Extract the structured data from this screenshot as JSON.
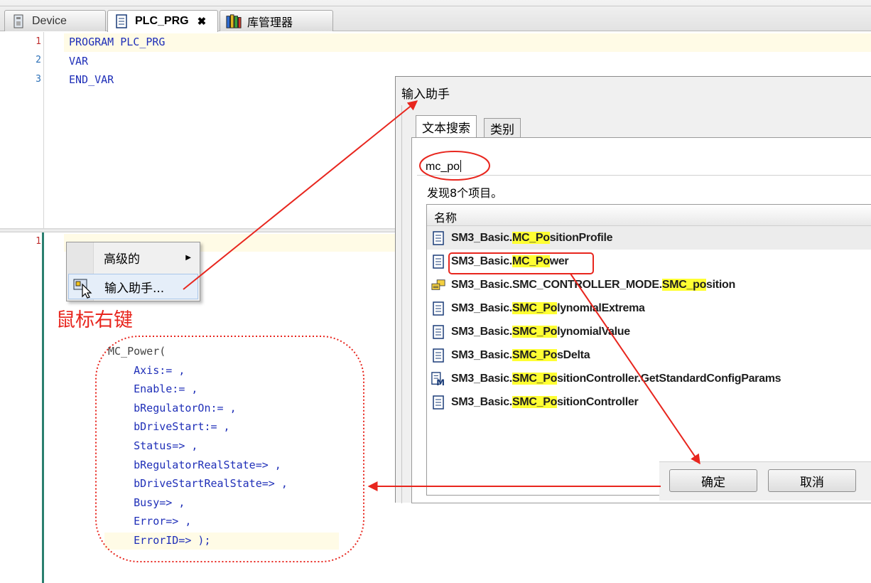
{
  "tabs": [
    {
      "label": "Device",
      "icon": "device-icon",
      "active": false
    },
    {
      "label": "PLC_PRG",
      "icon": "document-icon",
      "active": true
    },
    {
      "label": "库管理器",
      "icon": "books-icon",
      "active": false
    }
  ],
  "tab_close_glyph": "✖",
  "top_editor": {
    "line_numbers": [
      "1",
      "2",
      "3"
    ],
    "lines": [
      "PROGRAM PLC_PRG",
      "VAR",
      "END_VAR"
    ]
  },
  "bottom_editor": {
    "line_numbers": [
      "1"
    ],
    "code_lines": [
      "MC_Power(",
      "    Axis:= ,",
      "    Enable:= ,",
      "    bRegulatorOn:= ,",
      "    bDriveStart:= ,",
      "    Status=> ,",
      "    bRegulatorRealState=> ,",
      "    bDriveStartRealState=> ,",
      "    Busy=> ,",
      "    Error=> ,",
      "    ErrorID=> );"
    ]
  },
  "context_menu": {
    "items": [
      {
        "label": "高级的",
        "has_submenu": true
      },
      {
        "label": "输入助手...",
        "icon": "input-assistant-icon"
      }
    ],
    "submenu_arrow": "▶"
  },
  "annotation": {
    "label": "鼠标右键",
    "color": "#e8261e"
  },
  "dialog": {
    "title": "输入助手",
    "tabs": [
      "文本搜索",
      "类别"
    ],
    "search_value": "mc_po",
    "found_text": "发现8个项目。",
    "column_header": "名称",
    "results": [
      {
        "icon": "function-block-icon",
        "segments": [
          "SM3_Basic.",
          "MC_Po",
          "sitionProfile"
        ]
      },
      {
        "icon": "function-block-icon",
        "segments": [
          "SM3_Basic.",
          "MC_Po",
          "wer"
        ]
      },
      {
        "icon": "enum-value-icon",
        "segments": [
          "SM3_Basic.SMC_CONTROLLER_MODE.",
          "SMC_po",
          "sition"
        ]
      },
      {
        "icon": "function-block-icon",
        "segments": [
          "SM3_Basic.",
          "SMC_Po",
          "lynomialExtrema"
        ]
      },
      {
        "icon": "function-block-icon",
        "segments": [
          "SM3_Basic.",
          "SMC_Po",
          "lynomialValue"
        ]
      },
      {
        "icon": "function-block-icon",
        "segments": [
          "SM3_Basic.",
          "SMC_Po",
          "sDelta"
        ]
      },
      {
        "icon": "method-icon",
        "segments": [
          "SM3_Basic.",
          "SMC_Po",
          "sitionController.GetStandardConfigParams"
        ]
      },
      {
        "icon": "function-block-icon",
        "segments": [
          "SM3_Basic.",
          "SMC_Po",
          "sitionController"
        ]
      }
    ],
    "ok_label": "确定",
    "cancel_label": "取消"
  },
  "colors": {
    "highlight": "#ffff33",
    "annotation_red": "#e8261e",
    "keyword_blue": "#1f2fb8",
    "line_number_blue": "#2b6fb6"
  }
}
